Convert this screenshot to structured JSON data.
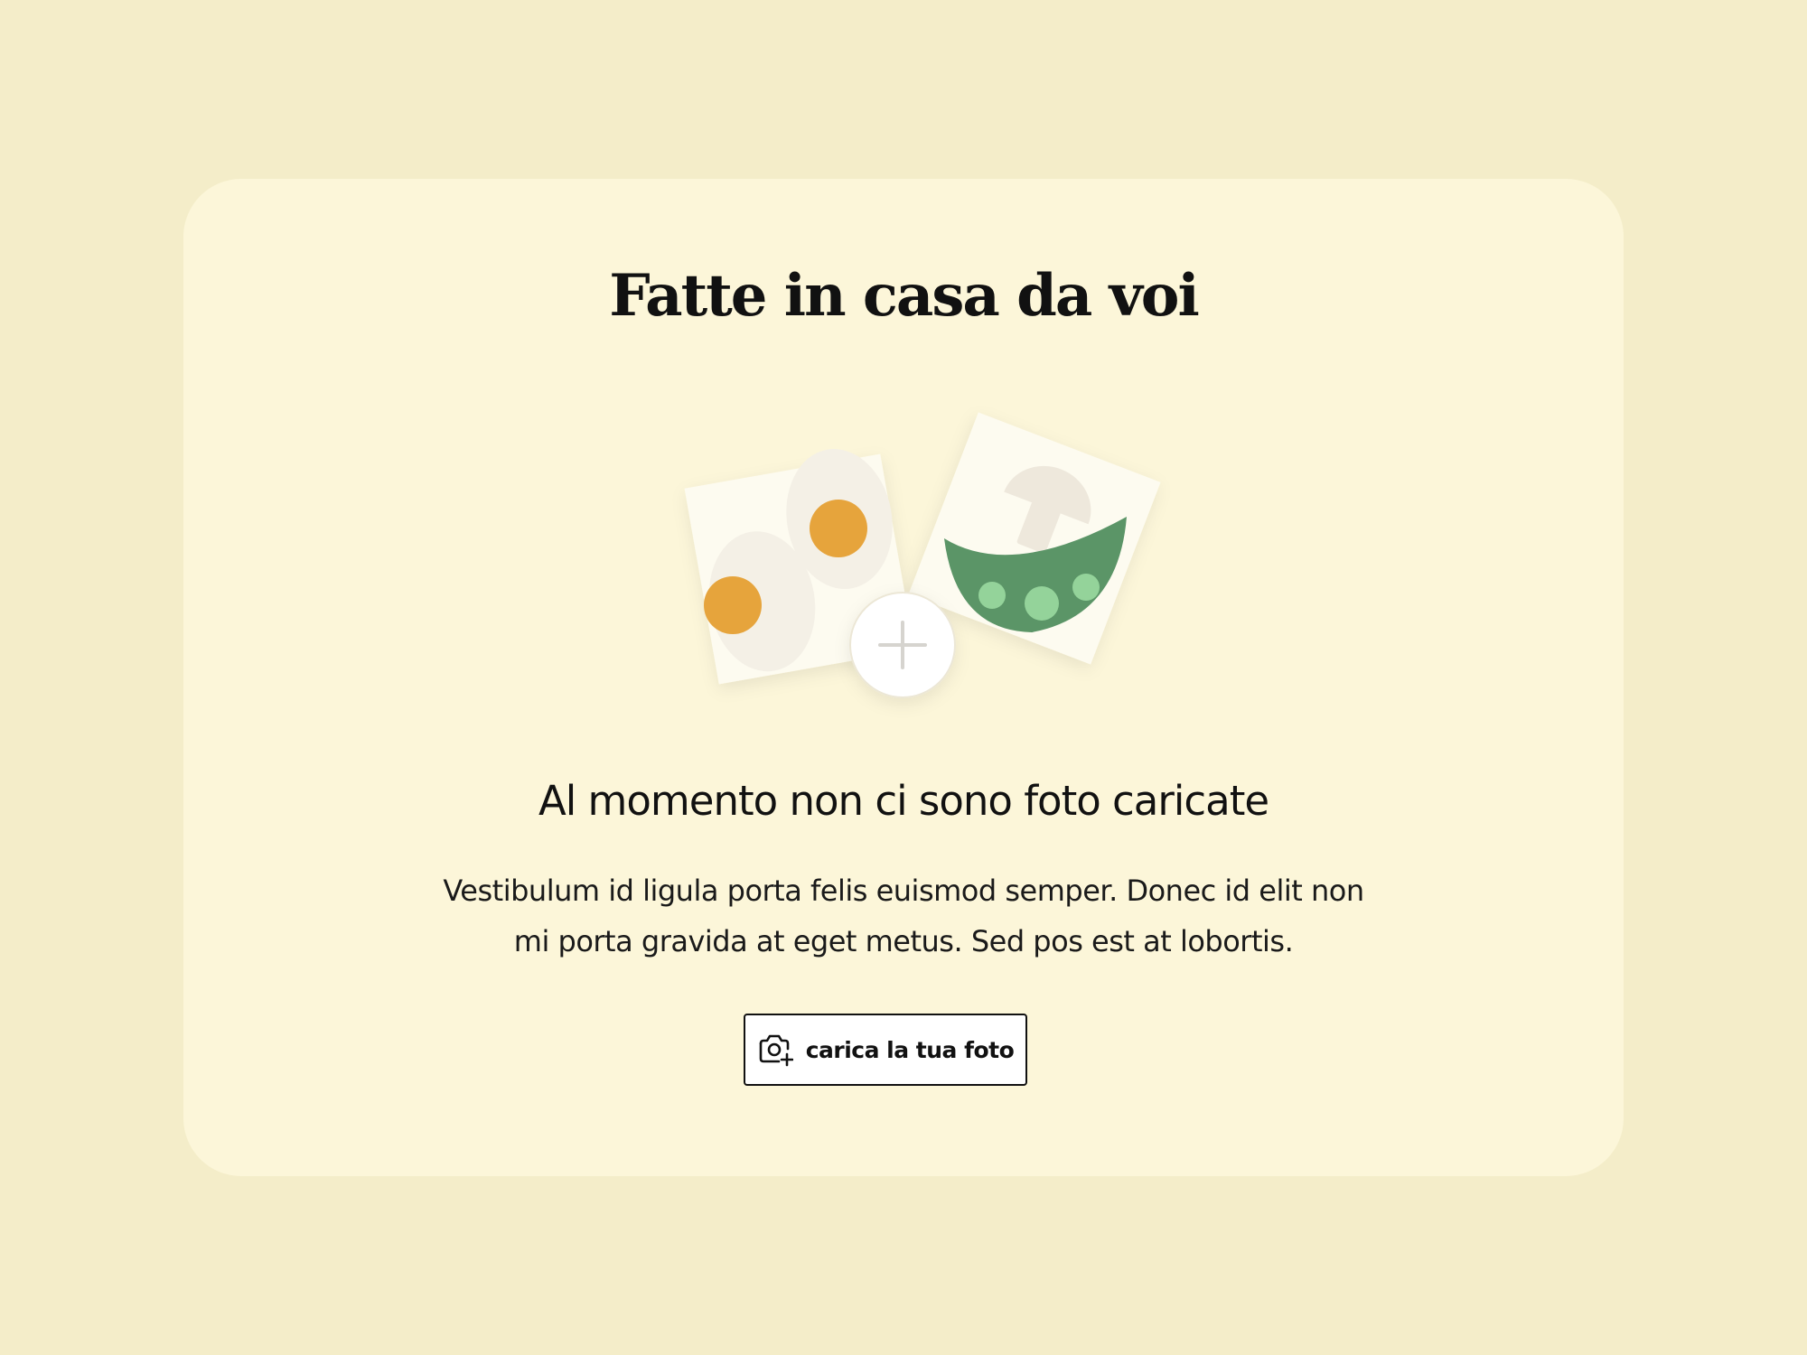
{
  "card": {
    "title": "Fatte in casa da voi"
  },
  "empty_state": {
    "heading": "Al momento non ci sono foto caricate",
    "body": "Vestibulum id ligula porta felis euismod semper. Donec id elit non mi porta gravida at eget metus. Sed pos est at lobortis.",
    "illustration": {
      "photo_left": "eggs",
      "photo_right": "mushroom-and-peas",
      "center_icon": "plus-icon"
    }
  },
  "upload_button": {
    "label": "carica la tua foto",
    "icon": "camera-add-icon"
  },
  "colors": {
    "page_background": "#f4edc9",
    "card_background": "#fcf6d9",
    "yolk": "#e6a43c",
    "pea_pod": "#5b9567",
    "pea": "#94d39a",
    "text": "#111111"
  }
}
